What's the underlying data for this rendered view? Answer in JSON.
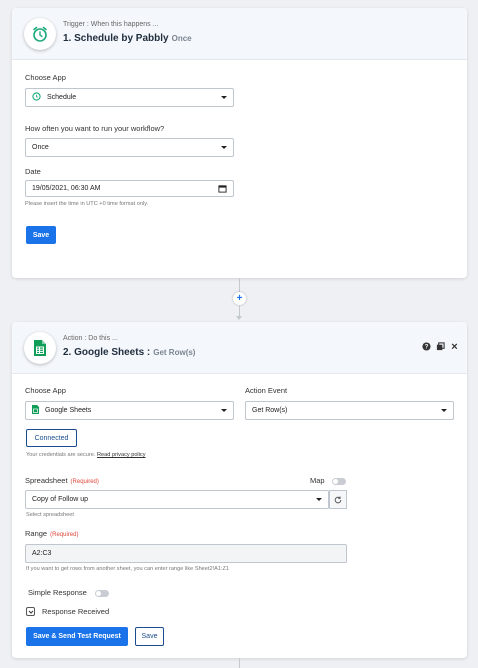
{
  "trigger": {
    "subtitle": "Trigger : When this happens ...",
    "title": "1. Schedule by Pabbly",
    "title_tag": "Once",
    "choose_app_label": "Choose App",
    "choose_app_value": "Schedule",
    "frequency_label": "How often you want to run your workflow?",
    "frequency_value": "Once",
    "date_label": "Date",
    "date_value": "19/05/2021, 06:30 AM",
    "date_hint": "Please insert the time in UTC +0 time format only.",
    "save_label": "Save"
  },
  "connector": {
    "add_label": "+"
  },
  "action": {
    "subtitle": "Action : Do this ...",
    "title": "2. Google Sheets :",
    "title_tag": "Get Row(s)",
    "help_icon": "?",
    "copy_icon": "copy",
    "close_icon": "×",
    "choose_app_label": "Choose App",
    "choose_app_value": "Google Sheets",
    "action_event_label": "Action Event",
    "action_event_value": "Get Row(s)",
    "connected_label": "Connected",
    "credentials_text": "Your credentials are secure.",
    "privacy_link": "Read privacy policy",
    "spreadsheet_label": "Spreadsheet",
    "required_text": "(Required)",
    "map_label": "Map",
    "spreadsheet_value": "Copy of Follow up",
    "spreadsheet_hint": "Select spreadsheet",
    "range_label": "Range",
    "range_value": "A2:C3",
    "range_hint": "If you want to get rows from another sheet, you can enter range like Sheet2!A1:Z1",
    "simple_response_label": "Simple Response",
    "response_received_label": "Response Received",
    "send_test_label": "Save & Send Test Request",
    "save_label": "Save"
  },
  "colors": {
    "accent": "#1a73e8",
    "schedule_green": "#1aaa7c",
    "sheets_green": "#0f9d58"
  }
}
